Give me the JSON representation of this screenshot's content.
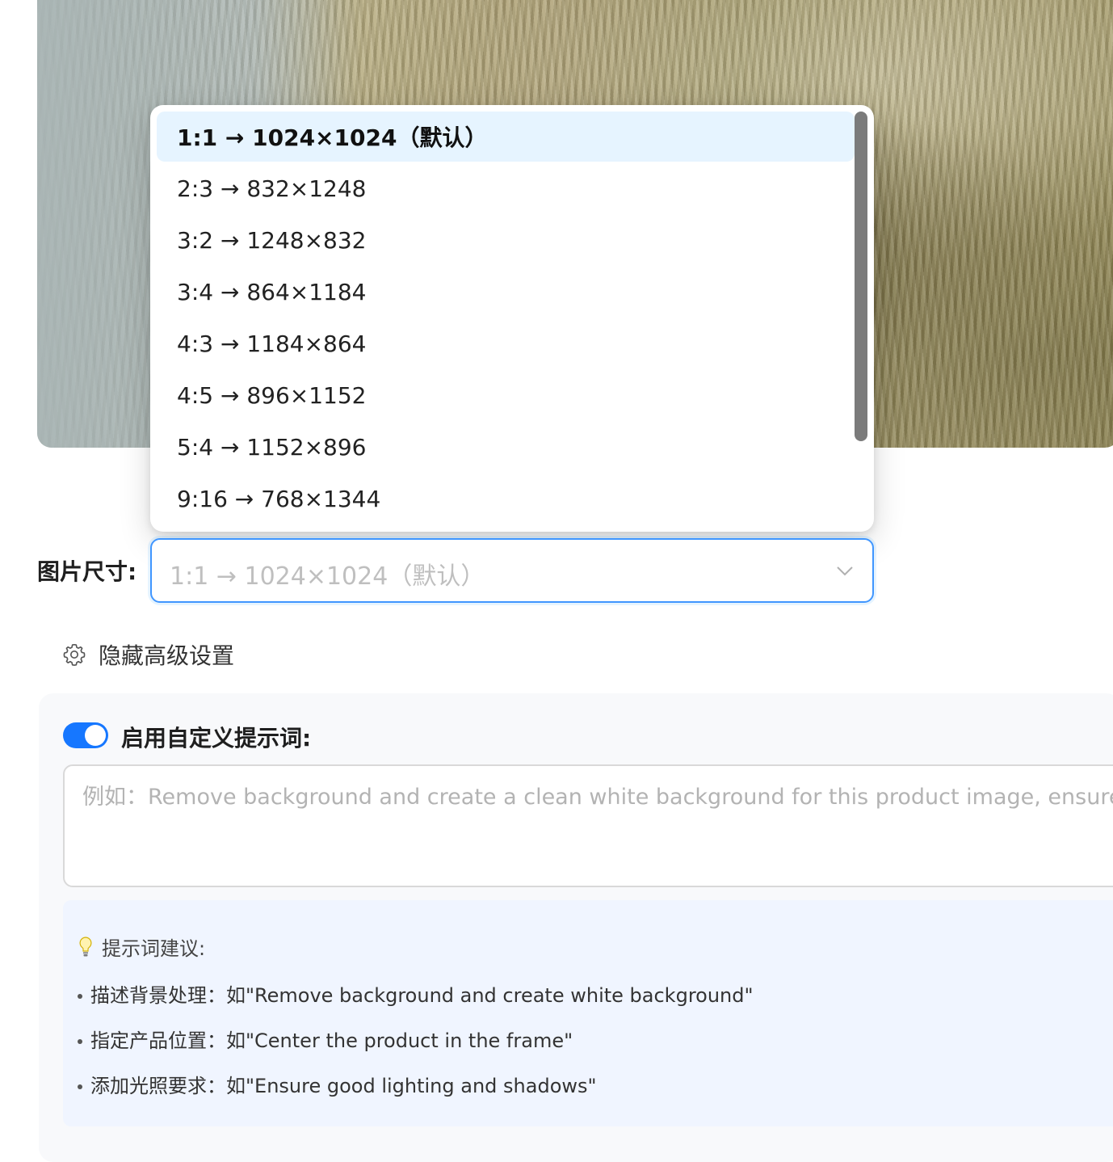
{
  "dropdown": {
    "options": [
      "1:1 → 1024×1024（默认）",
      "2:3 → 832×1248",
      "3:2 → 1248×832",
      "3:4 → 864×1184",
      "4:3 → 1184×864",
      "4:5 → 896×1152",
      "5:4 → 1152×896",
      "9:16 → 768×1344"
    ],
    "selected_index": 0
  },
  "image_size": {
    "label": "图片尺寸:",
    "value": "1:1 → 1024×1024（默认）"
  },
  "advanced": {
    "toggle_label": "隐藏高级设置"
  },
  "custom_prompt": {
    "enabled": true,
    "label": "启用自定义提示词:",
    "placeholder": "例如：Remove background and create a clean white background for this product image, ensure the"
  },
  "tips": {
    "title": "提示词建议:",
    "items": [
      "描述背景处理：如\"Remove background and create white background\"",
      "指定产品位置：如\"Center the product in the frame\"",
      "添加光照要求：如\"Ensure good lighting and shadows\""
    ]
  },
  "colors": {
    "accent": "#1677ff",
    "selected_bg": "#e6f4ff",
    "tips_bg": "#f0f5ff"
  }
}
